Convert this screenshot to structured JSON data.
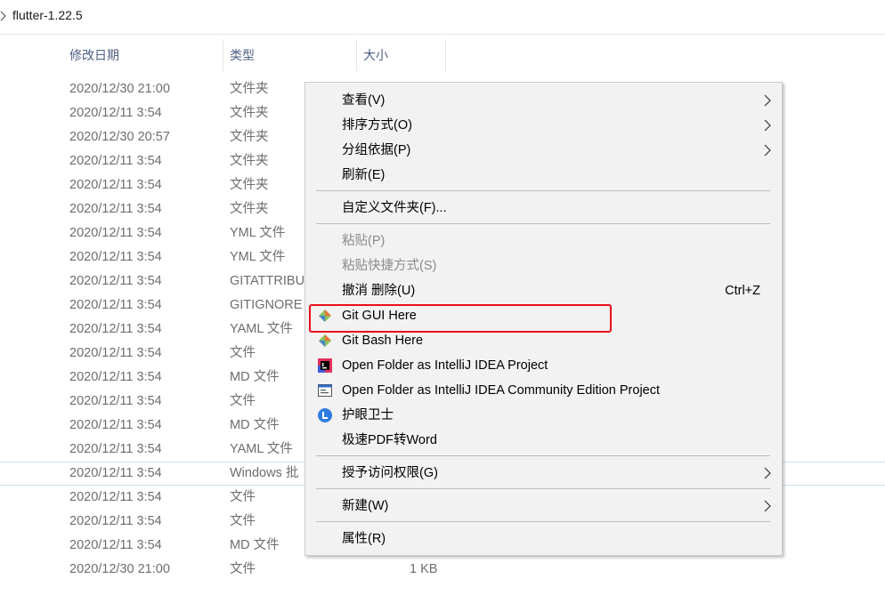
{
  "breadcrumb": {
    "folder": "flutter-1.22.5"
  },
  "columns": {
    "date": "修改日期",
    "type": "类型",
    "size": "大小"
  },
  "rows": [
    {
      "date": "2020/12/30 21:00",
      "type": "文件夹",
      "size": ""
    },
    {
      "date": "2020/12/11 3:54",
      "type": "文件夹",
      "size": ""
    },
    {
      "date": "2020/12/30 20:57",
      "type": "文件夹",
      "size": ""
    },
    {
      "date": "2020/12/11 3:54",
      "type": "文件夹",
      "size": ""
    },
    {
      "date": "2020/12/11 3:54",
      "type": "文件夹",
      "size": ""
    },
    {
      "date": "2020/12/11 3:54",
      "type": "文件夹",
      "size": ""
    },
    {
      "date": "2020/12/11 3:54",
      "type": "YML 文件",
      "size": ""
    },
    {
      "date": "2020/12/11 3:54",
      "type": "YML 文件",
      "size": ""
    },
    {
      "date": "2020/12/11 3:54",
      "type": "GITATTRIBU",
      "size": ""
    },
    {
      "date": "2020/12/11 3:54",
      "type": "GITIGNORE",
      "size": ""
    },
    {
      "date": "2020/12/11 3:54",
      "type": "YAML 文件",
      "size": ""
    },
    {
      "date": "2020/12/11 3:54",
      "type": "文件",
      "size": ""
    },
    {
      "date": "2020/12/11 3:54",
      "type": "MD 文件",
      "size": ""
    },
    {
      "date": "2020/12/11 3:54",
      "type": "文件",
      "size": ""
    },
    {
      "date": "2020/12/11 3:54",
      "type": "MD 文件",
      "size": ""
    },
    {
      "date": "2020/12/11 3:54",
      "type": "YAML 文件",
      "size": ""
    },
    {
      "date": "2020/12/11 3:54",
      "type": "Windows 批",
      "size": ""
    },
    {
      "date": "2020/12/11 3:54",
      "type": "文件",
      "size": ""
    },
    {
      "date": "2020/12/11 3:54",
      "type": "文件",
      "size": ""
    },
    {
      "date": "2020/12/11 3:54",
      "type": "MD 文件",
      "size": ""
    },
    {
      "date": "2020/12/30 21:00",
      "type": "文件",
      "size": "1 KB"
    }
  ],
  "context_menu": {
    "view": "查看(V)",
    "sort_by": "排序方式(O)",
    "group_by": "分组依据(P)",
    "refresh": "刷新(E)",
    "customize": "自定义文件夹(F)...",
    "paste": "粘贴(P)",
    "paste_shortcut": "粘贴快捷方式(S)",
    "undo_delete": "撤消 删除(U)",
    "undo_shortcut": "Ctrl+Z",
    "git_gui": "Git GUI Here",
    "git_bash": "Git Bash Here",
    "intellij": "Open Folder as IntelliJ IDEA Project",
    "intellij_ce": "Open Folder as IntelliJ IDEA Community Edition Project",
    "eye_guard": "护眼卫士",
    "pdf_word": "极速PDF转Word",
    "grant_access": "授予访问权限(G)",
    "new": "新建(W)",
    "properties": "属性(R)"
  },
  "colors": {
    "highlight": "#e8101a",
    "selection_border": "#cce4f7",
    "header_text": "#4d6082"
  }
}
